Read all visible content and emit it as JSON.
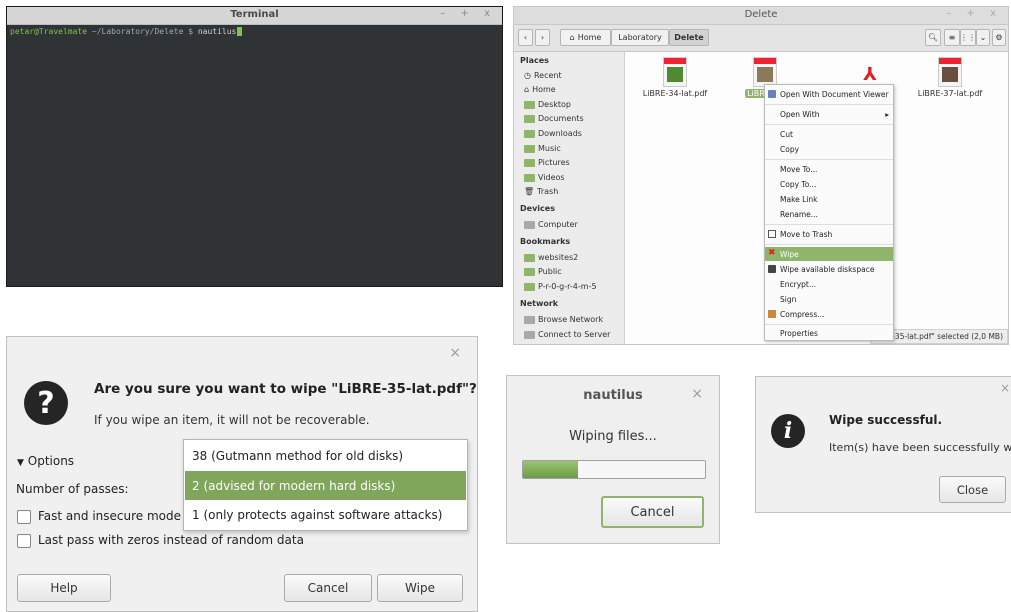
{
  "terminal": {
    "title": "Terminal",
    "window_controls": "– + x",
    "prompt_user": "petar@Travelmate",
    "prompt_path": " ~/Laboratory/Delete $ ",
    "command": "nautilus"
  },
  "file_manager": {
    "title": "Delete",
    "window_controls": "– + x",
    "breadcrumb": [
      "Home",
      "Laboratory",
      "Delete"
    ],
    "sidebar": {
      "places_header": "Places",
      "places": [
        "Recent",
        "Home",
        "Desktop",
        "Documents",
        "Downloads",
        "Music",
        "Pictures",
        "Videos",
        "Trash"
      ],
      "devices_header": "Devices",
      "devices": [
        "Computer"
      ],
      "bookmarks_header": "Bookmarks",
      "bookmarks": [
        "websites2",
        "Public",
        "P-r-0-g-r-4-m-5"
      ],
      "network_header": "Network",
      "network": [
        "Browse Network",
        "Connect to Server"
      ]
    },
    "files": [
      "LiBRE-34-lat.pdf",
      "LiBRE-35",
      "",
      "LiBRE-37-lat.pdf"
    ],
    "status": "iBRE-35-lat.pdf\" selected (2,0 MB)"
  },
  "context_menu": {
    "items": [
      "Open With Document Viewer",
      "Open With",
      "Cut",
      "Copy",
      "Move To...",
      "Copy To...",
      "Make Link",
      "Rename...",
      "Move to Trash",
      "Wipe",
      "Wipe available diskspace",
      "Encrypt...",
      "Sign",
      "Compress...",
      "Properties"
    ],
    "highlight_color": "#8fb56a"
  },
  "confirm_dialog": {
    "title": "Are you sure you want to wipe \"LiBRE-35-lat.pdf\"?",
    "subtitle": "If you wipe an item, it will not be recoverable.",
    "options_label": "Options",
    "passes_label": "Number of passes:",
    "fast_mode_label": "Fast and insecure mode (",
    "zeros_label": "Last pass with zeros instead of random data",
    "help_button": "Help",
    "cancel_button": "Cancel",
    "wipe_button": "Wipe",
    "close": "×"
  },
  "passes_dropdown": {
    "options": [
      "38 (Gutmann method for old disks)",
      "2  (advised for modern hard disks)",
      "1  (only protects against software attacks)"
    ],
    "selected_index": 1
  },
  "progress_dialog": {
    "title": "nautilus",
    "message": "Wiping files...",
    "progress": 0.3,
    "cancel_button": "Cancel",
    "close": "×"
  },
  "success_dialog": {
    "title": "Wipe successful.",
    "message": "Item(s) have been successfully wiped.",
    "close_button": "Close",
    "close": "×"
  }
}
